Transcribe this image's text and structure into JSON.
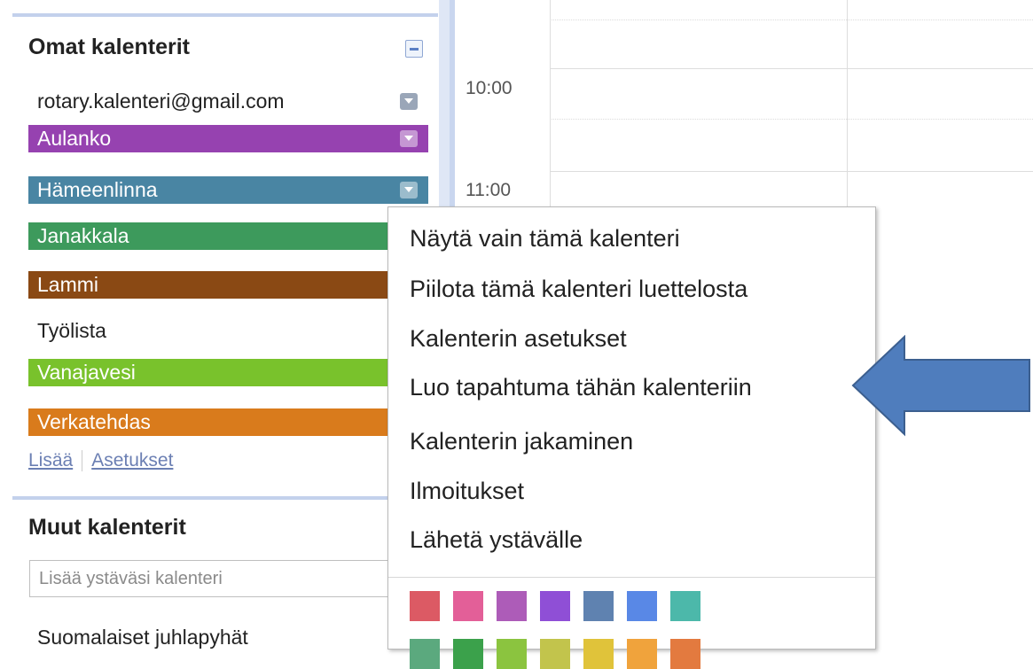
{
  "sidebar": {
    "my_calendars_title": "Omat kalenterit",
    "calendars": [
      {
        "label": "rotary.kalenteri@gmail.com",
        "color": ""
      },
      {
        "label": "Aulanko",
        "color": "#9642b0"
      },
      {
        "label": "Hämeenlinna",
        "color": "#4985a3"
      },
      {
        "label": "Janakkala",
        "color": "#3d9a5c"
      },
      {
        "label": "Lammi",
        "color": "#8a4914"
      },
      {
        "label": "Työlista",
        "color": ""
      },
      {
        "label": "Vanajavesi",
        "color": "#79c22c"
      },
      {
        "label": "Verkatehdas",
        "color": "#d97b1c"
      }
    ],
    "links": {
      "add": "Lisää",
      "settings": "Asetukset"
    },
    "other_calendars_title": "Muut kalenterit",
    "add_friend_placeholder": "Lisää ystäväsi kalenteri",
    "other_first_item": "Suomalaiset juhlapyhät"
  },
  "grid": {
    "times": [
      "10:00",
      "11:00"
    ]
  },
  "context_menu": {
    "items": [
      "Näytä vain tämä kalenteri",
      "Piilota tämä kalenteri luettelosta",
      "Kalenterin asetukset",
      "Luo tapahtuma tähän kalenteriin",
      "Kalenterin jakaminen",
      "Ilmoitukset",
      "Lähetä ystävälle"
    ],
    "swatch_colors_row1": [
      "#dc5a64",
      "#e35f98",
      "#ad5cb8",
      "#8f4fd6",
      "#5f82b0",
      "#5988e6",
      "#4cb8aa"
    ],
    "swatch_colors_row2": [
      "#5ba97e",
      "#3ba14b",
      "#8bc43f",
      "#c2c44c",
      "#e0c33a",
      "#f0a33c",
      "#e37a3f"
    ]
  },
  "annotation": {
    "arrow_color": "#4f7dbd",
    "arrow_target": "Luo tapahtuma tähän kalenteriin"
  }
}
